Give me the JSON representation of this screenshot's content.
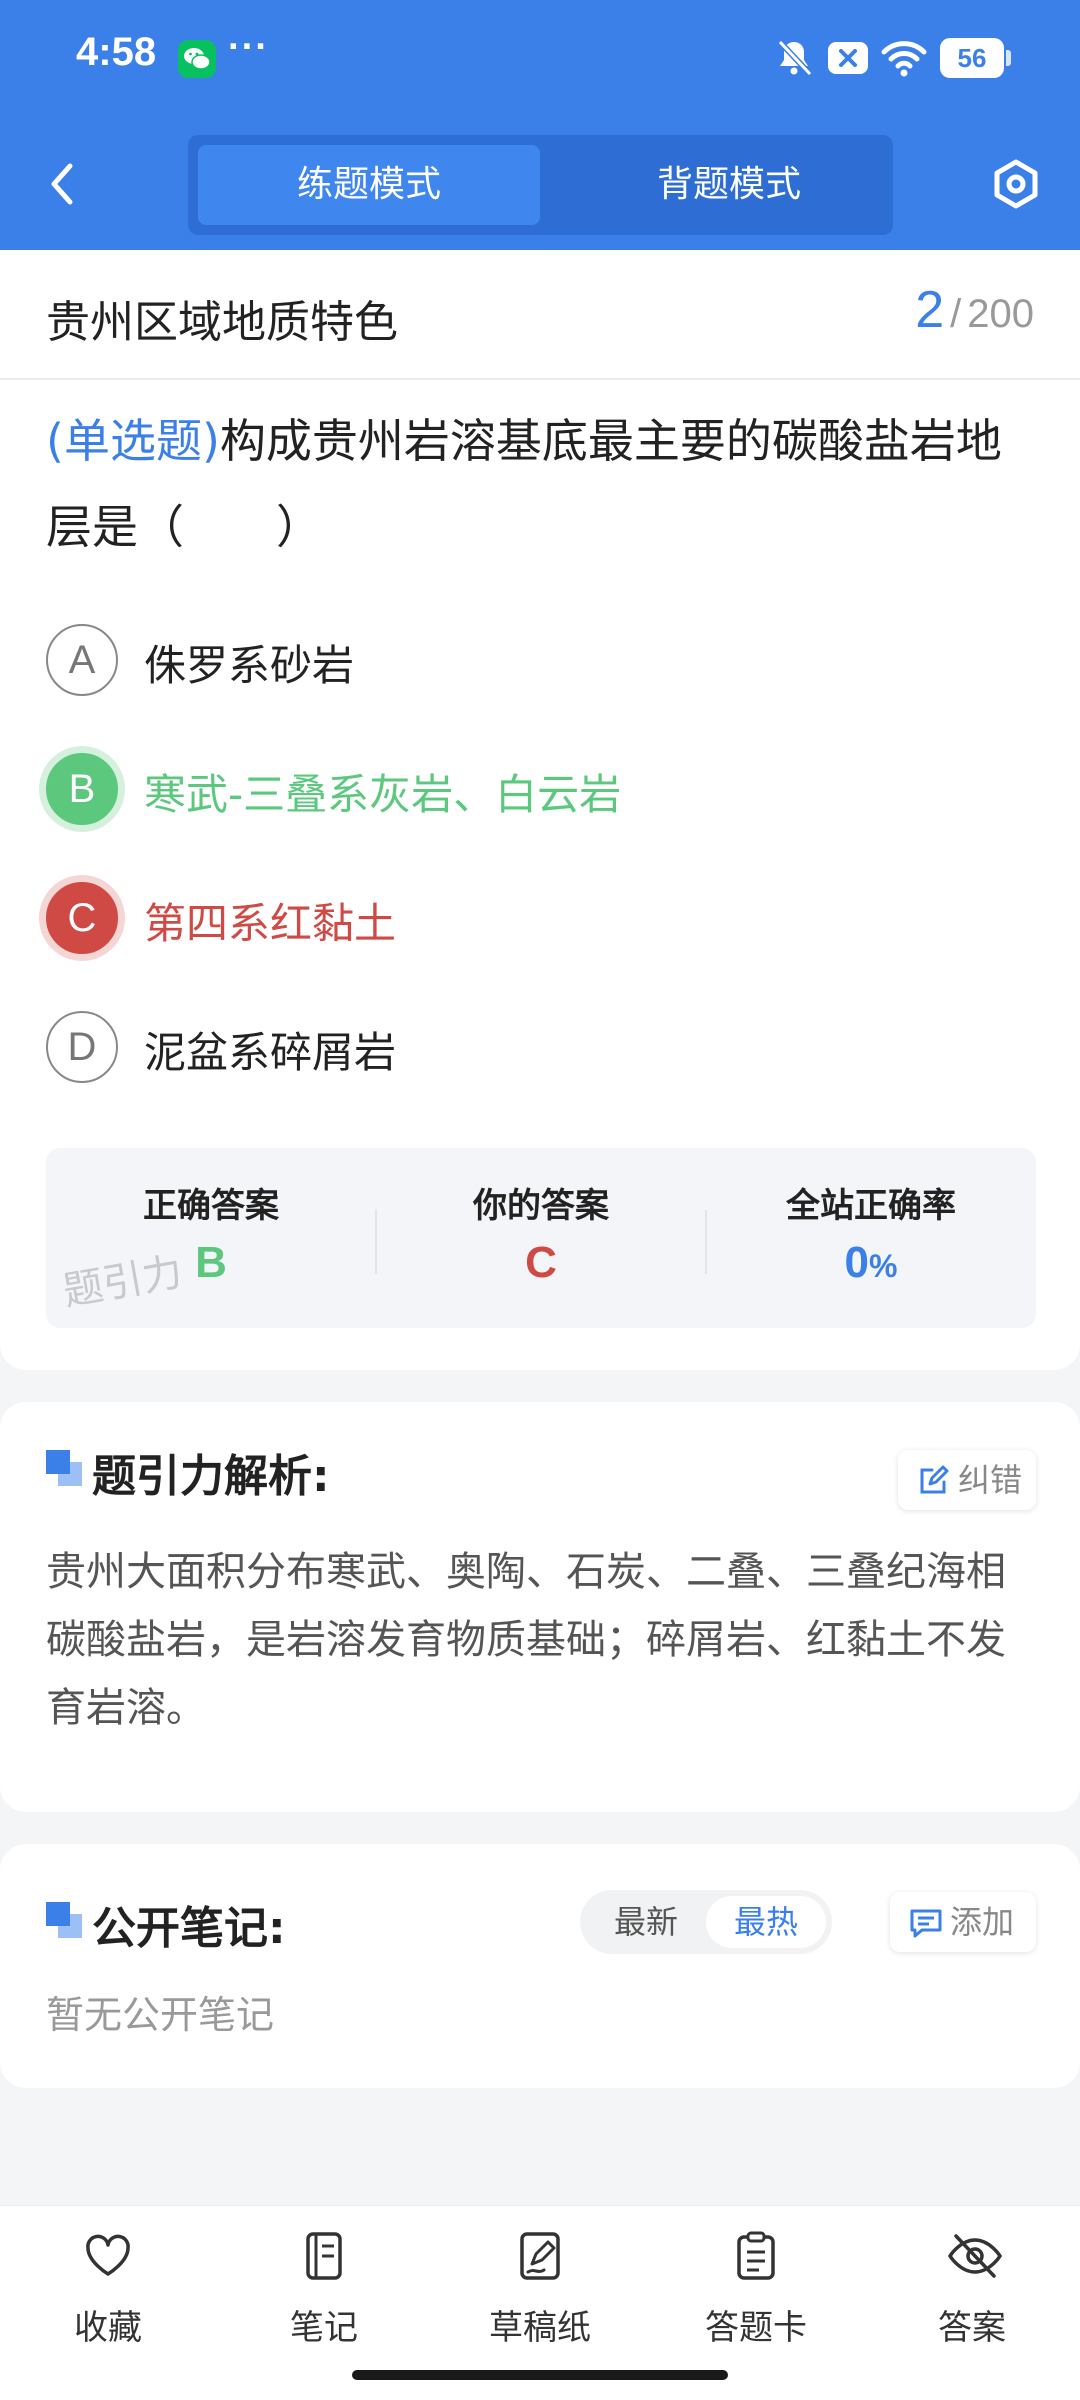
{
  "status_bar": {
    "time": "4:58",
    "dots": "···",
    "battery": "56"
  },
  "header": {
    "tabs": [
      "练题模式",
      "背题模式"
    ],
    "active_tab": "练题模式"
  },
  "question": {
    "chapter": "贵州区域地质特色",
    "current": "2",
    "separator": "/",
    "total": "200",
    "type_label": "(单选题)",
    "text": "构成贵州岩溶基底最主要的碳酸盐岩地层是（　　）",
    "options": [
      {
        "letter": "A",
        "text": "侏罗系砂岩",
        "state": "normal"
      },
      {
        "letter": "B",
        "text": "寒武-三叠系灰岩、白云岩",
        "state": "correct"
      },
      {
        "letter": "C",
        "text": "第四系红黏土",
        "state": "wrong"
      },
      {
        "letter": "D",
        "text": "泥盆系碎屑岩",
        "state": "normal"
      }
    ]
  },
  "answer_summary": {
    "correct_label": "正确答案",
    "correct_value": "B",
    "yours_label": "你的答案",
    "yours_value": "C",
    "rate_label": "全站正确率",
    "rate_value": "0",
    "rate_unit": "%",
    "watermark": "题引力"
  },
  "analysis": {
    "title": "题引力解析:",
    "report_label": "纠错",
    "text": "贵州大面积分布寒武、奥陶、石炭、二叠、三叠纪海相碳酸盐岩，是岩溶发育物质基础；碎屑岩、红黏土不发育岩溶。"
  },
  "notes": {
    "title": "公开笔记:",
    "sort_latest": "最新",
    "sort_hot": "最热",
    "add_label": "添加",
    "empty_text": "暂无公开笔记"
  },
  "bottom_nav": [
    {
      "label": "收藏",
      "icon": "heart-icon"
    },
    {
      "label": "笔记",
      "icon": "notebook-icon"
    },
    {
      "label": "草稿纸",
      "icon": "draft-pen-icon"
    },
    {
      "label": "答题卡",
      "icon": "clipboard-icon"
    },
    {
      "label": "答案",
      "icon": "eye-off-icon"
    }
  ],
  "colors": {
    "primary": "#3b7fe8",
    "correct": "#5cc87e",
    "wrong": "#cf4a45"
  }
}
